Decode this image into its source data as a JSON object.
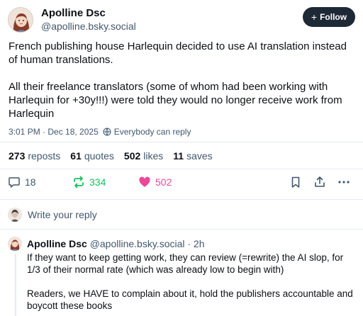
{
  "post": {
    "author_name": "Apolline Dsc",
    "author_handle": "@apolline.bsky.social",
    "follow_label": "Follow",
    "paragraphs": [
      "French publishing house Harlequin decided to use AI translation instead of human translations.",
      "All their freelance translators (some of whom had been working with Harlequin for +30y!!!) were told they would no longer receive work from Harlequin"
    ],
    "timestamp": "3:01 PM · Dec 18, 2025",
    "reply_setting": "Everybody can reply"
  },
  "stats": {
    "reposts_count": "273",
    "reposts_label": "reposts",
    "quotes_count": "61",
    "quotes_label": "quotes",
    "likes_count": "502",
    "likes_label": "likes",
    "saves_count": "11",
    "saves_label": "saves"
  },
  "actions": {
    "reply_count": "18",
    "repost_count": "334",
    "like_count": "502"
  },
  "colors": {
    "repost_active": "#13c25d",
    "like_active": "#ec4899",
    "icon_default": "#42576c"
  },
  "compose": {
    "placeholder": "Write your reply"
  },
  "reply": {
    "author_name": "Apolline Dsc",
    "author_handle": "@apolline.bsky.social",
    "time": "· 2h",
    "paragraphs": [
      "If they want to keep getting work, they can review (=rewrite) the AI slop, for 1/3 of their normal rate (which was already low to begin with)",
      "Readers, we HAVE to complain about it, hold the publishers accountable and boycott these books"
    ]
  }
}
